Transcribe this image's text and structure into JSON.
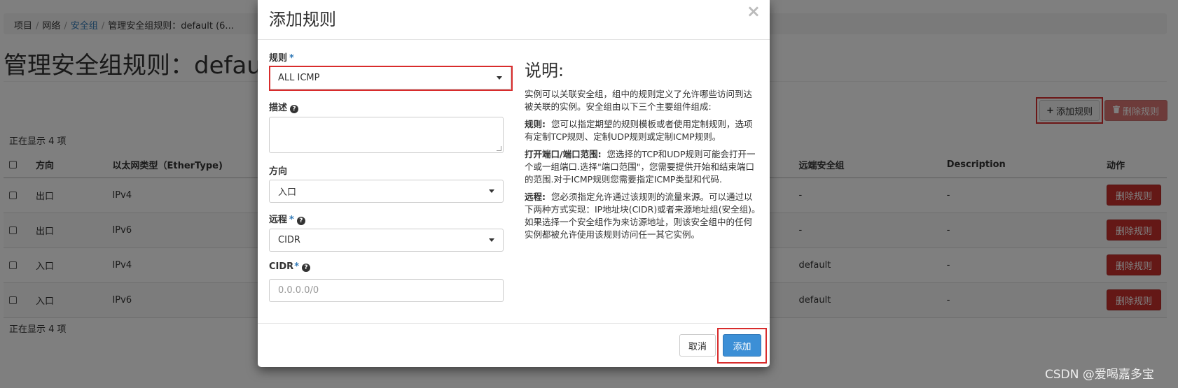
{
  "breadcrumb": {
    "items": [
      "项目",
      "网络",
      "安全组",
      "管理安全组规则：default (6..."
    ],
    "separator": "/"
  },
  "page": {
    "title": "管理安全组规则：default",
    "add_rule_label": "添加规则",
    "delete_rules_label": "删除规则",
    "count_top": "正在显示 4 项",
    "count_bottom": "正在显示 4 项"
  },
  "table": {
    "columns": {
      "direction": "方向",
      "ethertype": "以太网类型（EtherType)",
      "remote_group": "远端安全组",
      "description": "Description",
      "actions": "动作"
    },
    "rows": [
      {
        "direction": "出口",
        "ethertype": "IPv4",
        "remote_group": "-",
        "description": "-",
        "action": "删除规则"
      },
      {
        "direction": "出口",
        "ethertype": "IPv6",
        "remote_group": "-",
        "description": "-",
        "action": "删除规则"
      },
      {
        "direction": "入口",
        "ethertype": "IPv4",
        "remote_group": "default",
        "description": "-",
        "action": "删除规则"
      },
      {
        "direction": "入口",
        "ethertype": "IPv6",
        "remote_group": "default",
        "description": "-",
        "action": "删除规则"
      }
    ]
  },
  "modal": {
    "title": "添加规则",
    "close": "×",
    "rule_label": "规则",
    "rule_value": "ALL ICMP",
    "description_label": "描述",
    "direction_label": "方向",
    "direction_value": "入口",
    "remote_label": "远程",
    "remote_value": "CIDR",
    "cidr_label": "CIDR",
    "cidr_placeholder": "0.0.0.0/0",
    "required_mark": "*",
    "help_glyph": "?",
    "cancel_label": "取消",
    "submit_label": "添加"
  },
  "help": {
    "title": "说明:",
    "intro": "实例可以关联安全组，组中的规则定义了允许哪些访问到达被关联的实例。安全组由以下三个主要组件组成:",
    "rule_term": "规则:",
    "rule_text": "您可以指定期望的规则模板或者使用定制规则，选项有定制TCP规则、定制UDP规则或定制ICMP规则。",
    "port_term": "打开端口/端口范围:",
    "port_text": "您选择的TCP和UDP规则可能会打开一个或一组端口.选择\"端口范围\"，您需要提供开始和结束端口的范围.对于ICMP规则您需要指定ICMP类型和代码.",
    "remote_term": "远程:",
    "remote_text": "您必须指定允许通过该规则的流量来源。可以通过以下两种方式实现：IP地址块(CIDR)或者来源地址组(安全组)。如果选择一个安全组作为来访源地址，则该安全组中的任何实例都被允许使用该规则访问任一其它实例。"
  },
  "watermark": "CSDN @爱喝嘉多宝"
}
